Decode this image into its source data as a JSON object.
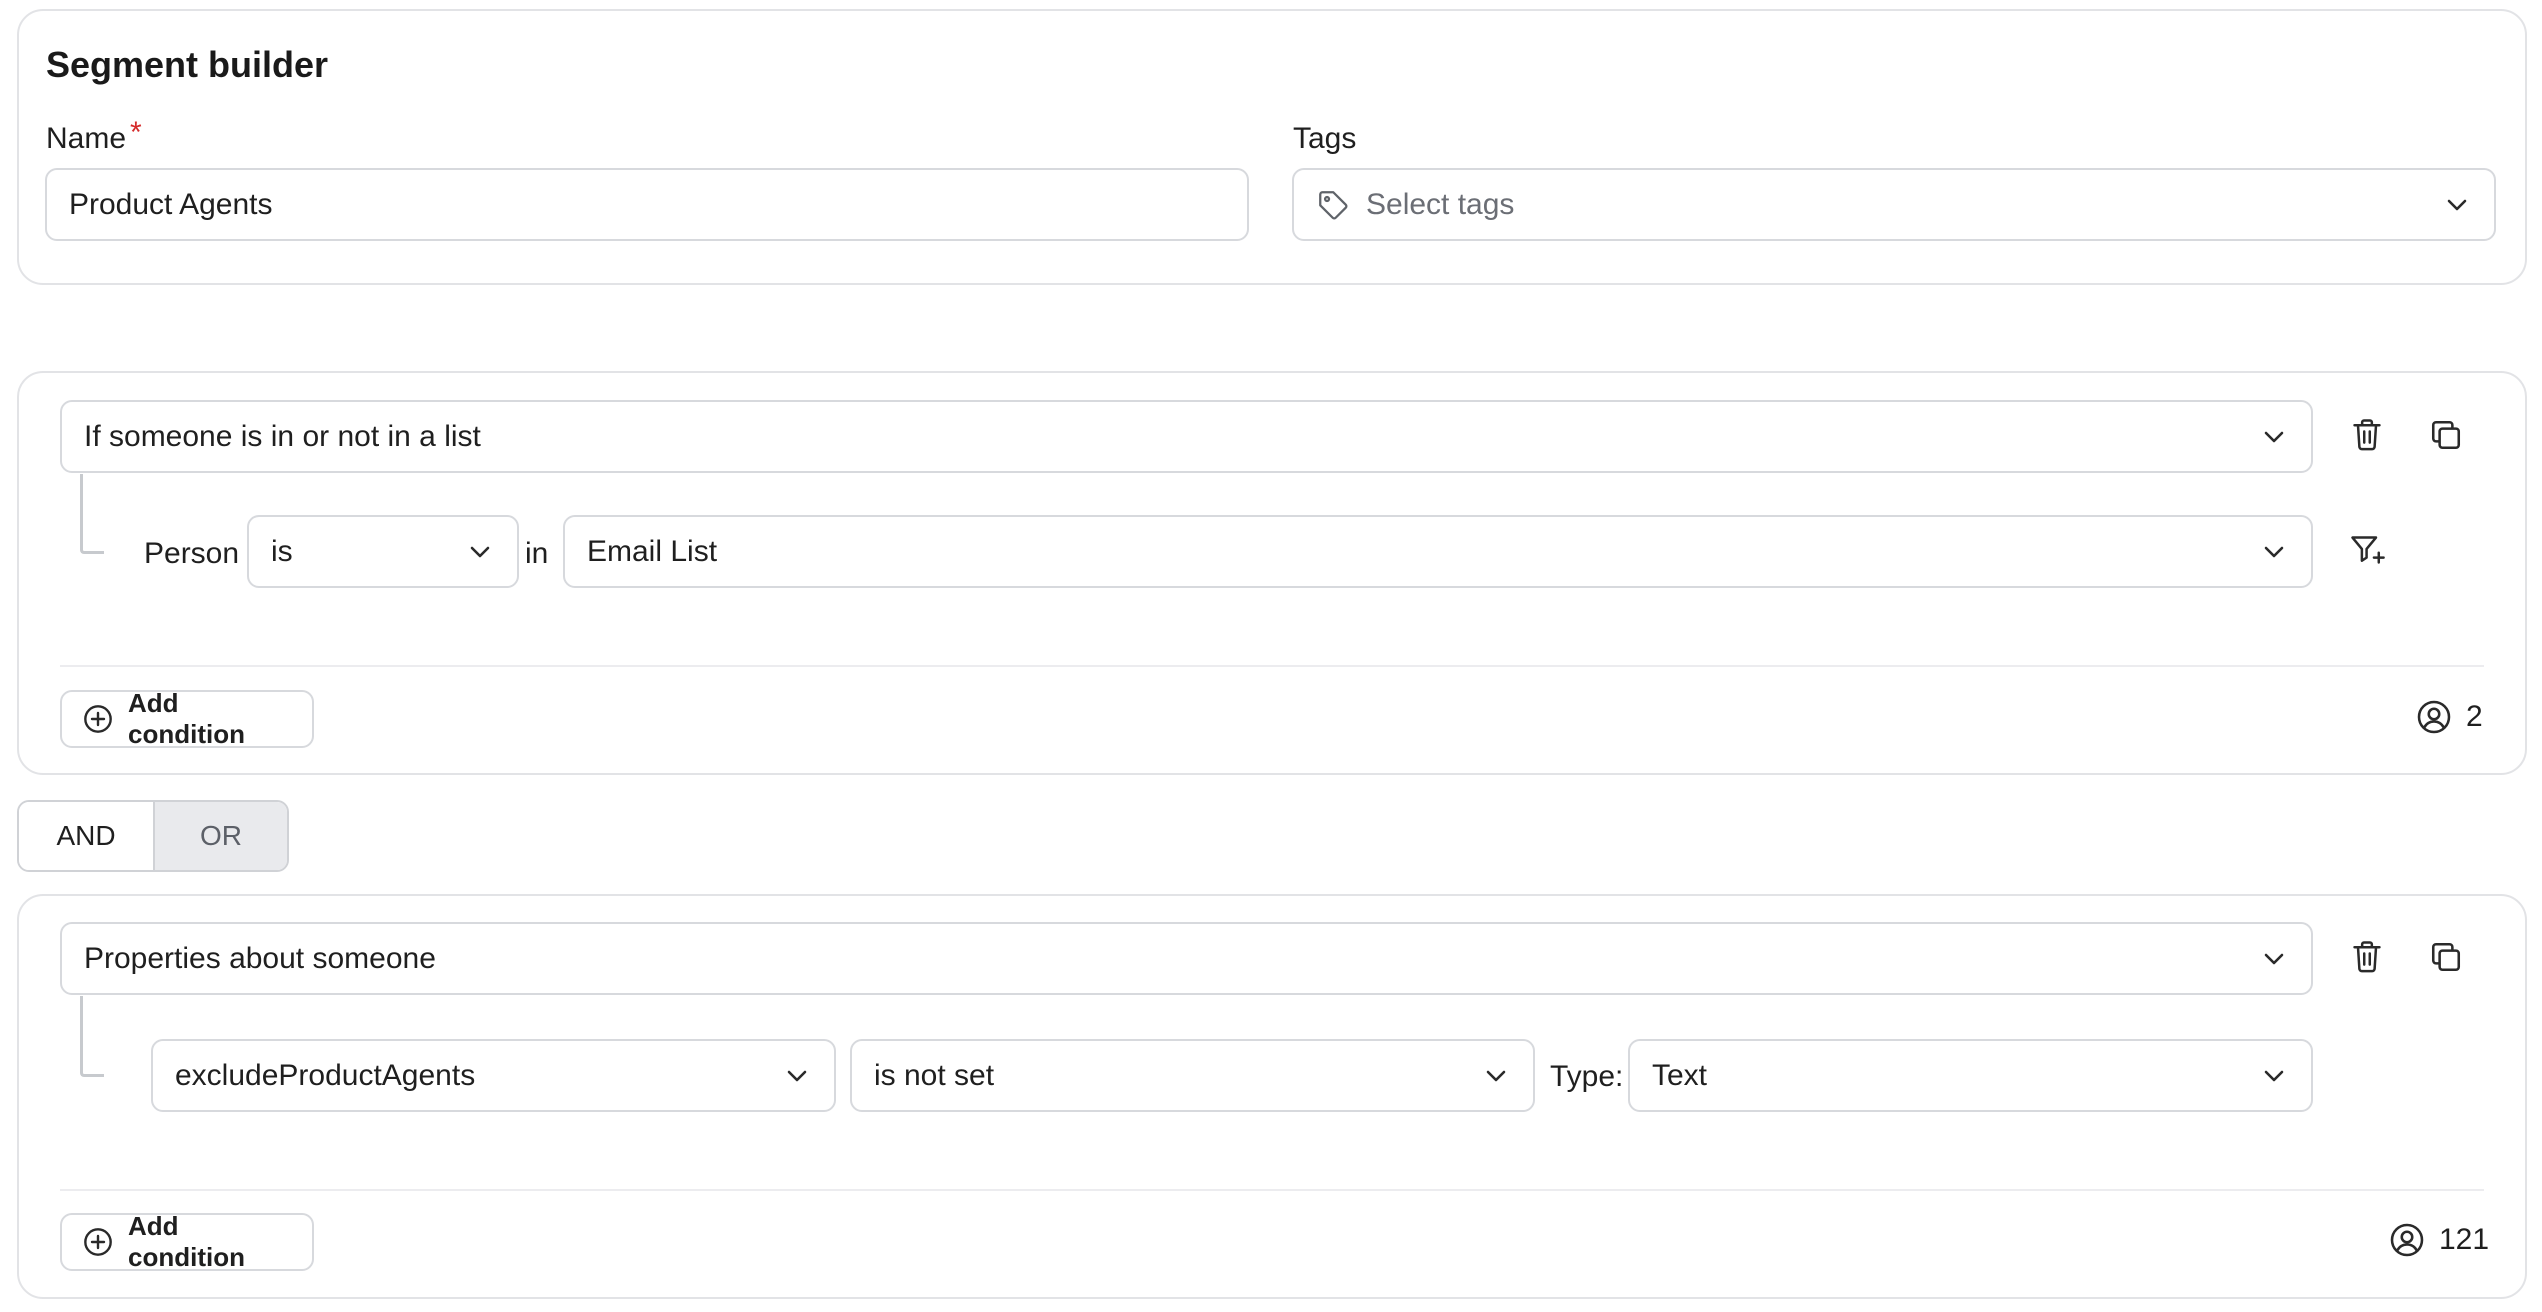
{
  "header": {
    "title": "Segment builder",
    "name_label": "Name",
    "required_mark": "*",
    "name_value": "Product Agents",
    "tags_label": "Tags",
    "tags_placeholder": "Select tags"
  },
  "group1": {
    "type_value": "If someone is in or not in a list",
    "subject_label": "Person",
    "operator_value": "is",
    "preposition": "in",
    "list_value": "Email List",
    "add_condition_label": "Add condition",
    "count": "2"
  },
  "combinator": {
    "options": [
      "AND",
      "OR"
    ],
    "selected": "AND"
  },
  "group2": {
    "type_value": "Properties about someone",
    "property_value": "excludeProductAgents",
    "operator_value": "is not set",
    "type_label": "Type:",
    "data_type_value": "Text",
    "add_condition_label": "Add condition",
    "count": "121"
  },
  "icons": {
    "tag": "tag-icon",
    "chevron": "chevron-down-icon",
    "trash": "trash-icon",
    "copy": "copy-icon",
    "filter_add": "filter-plus-icon",
    "plus_circle": "plus-circle-icon",
    "user_circle": "user-circle-icon"
  },
  "colors": {
    "required": "#d52b2b",
    "border": "#d7d9dd",
    "inactive_toggle": "#e9eaed"
  }
}
